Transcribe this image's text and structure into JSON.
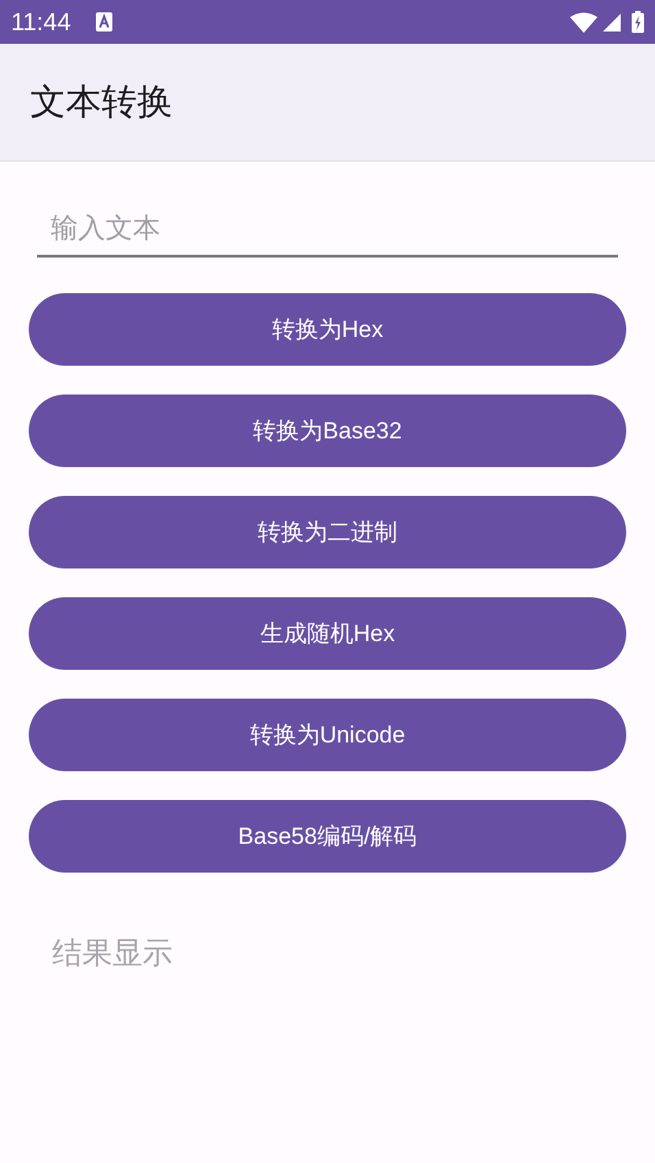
{
  "status_bar": {
    "time": "11:44"
  },
  "app_bar": {
    "title": "文本转换"
  },
  "input": {
    "placeholder": "输入文本"
  },
  "buttons": [
    {
      "label": "转换为Hex"
    },
    {
      "label": "转换为Base32"
    },
    {
      "label": "转换为二进制"
    },
    {
      "label": "生成随机Hex"
    },
    {
      "label": "转换为Unicode"
    },
    {
      "label": "Base58编码/解码"
    }
  ],
  "result": {
    "placeholder": "结果显示"
  }
}
